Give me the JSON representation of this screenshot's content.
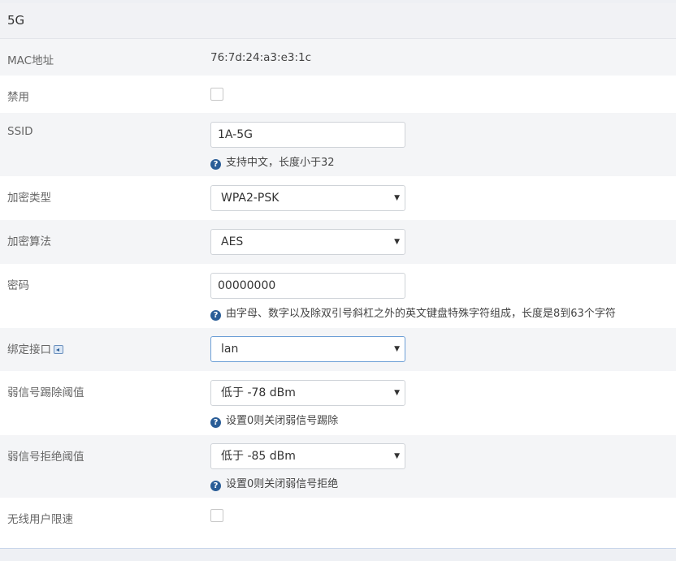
{
  "section": {
    "title": "5G"
  },
  "fields": {
    "mac": {
      "label": "MAC地址",
      "value": "76:7d:24:a3:e3:1c"
    },
    "disable": {
      "label": "禁用",
      "checked": false
    },
    "ssid": {
      "label": "SSID",
      "value": "1A-5G",
      "hint": "支持中文，长度小于32"
    },
    "encryption_type": {
      "label": "加密类型",
      "value": "WPA2-PSK"
    },
    "encryption_algo": {
      "label": "加密算法",
      "value": "AES"
    },
    "password": {
      "label": "密码",
      "value": "00000000",
      "hint": "由字母、数字以及除双引号斜杠之外的英文键盘特殊字符组成，长度是8到63个字符"
    },
    "bind_interface": {
      "label": "绑定接口",
      "value": "lan"
    },
    "weak_kick": {
      "label": "弱信号踢除阈值",
      "value": "低于 -78 dBm",
      "hint": "设置0则关闭弱信号踢除"
    },
    "weak_reject": {
      "label": "弱信号拒绝阈值",
      "value": "低于 -85 dBm",
      "hint": "设置0则关闭弱信号拒绝"
    },
    "rate_limit": {
      "label": "无线用户限速",
      "checked": false
    }
  },
  "icons": {
    "help": "question-circle-icon",
    "caret": "caret-down-icon",
    "interface_link": "interface-link-icon"
  },
  "colors": {
    "accent": "#2a5d97",
    "row_alt": "#f4f5f7",
    "focus_border": "#6d9fd6"
  }
}
